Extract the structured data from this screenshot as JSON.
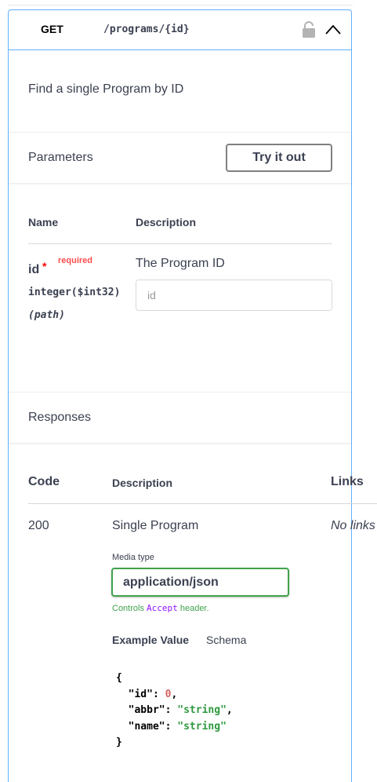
{
  "operation": {
    "method": "GET",
    "path": "/programs/{id}",
    "summary": "Find a single Program by ID"
  },
  "parameters": {
    "title": "Parameters",
    "try_it_out": "Try it out",
    "col_name": "Name",
    "col_description": "Description",
    "items": [
      {
        "name": "id",
        "required_star": "*",
        "required_label": "required",
        "type": "integer($int32)",
        "in": "(path)",
        "description": "The Program ID",
        "placeholder": "id"
      }
    ]
  },
  "responses": {
    "title": "Responses",
    "col_code": "Code",
    "col_description": "Description",
    "col_links": "Links",
    "items": [
      {
        "code": "200",
        "description": "Single Program",
        "links": "No links",
        "media_type_label": "Media type",
        "media_type": "application/json",
        "controls_prefix": "Controls",
        "controls_code": "Accept",
        "controls_suffix": "header.",
        "tab_example": "Example Value",
        "tab_schema": "Schema",
        "example": {
          "open": "{",
          "lines": [
            {
              "key": "\"id\"",
              "value": "0",
              "kind": "num",
              "trail": ","
            },
            {
              "key": "\"abbr\"",
              "value": "\"string\"",
              "kind": "str",
              "trail": ","
            },
            {
              "key": "\"name\"",
              "value": "\"string\"",
              "kind": "str",
              "trail": ""
            }
          ],
          "close": "}"
        }
      }
    ]
  },
  "colors": {
    "get_border": "#61affe",
    "media_select_border": "#41a24b",
    "required_red": "#ff0000",
    "example_number": "#d36363",
    "example_string": "#2e9a3f"
  },
  "icons": [
    "lock-icon",
    "chevron-up-icon"
  ]
}
